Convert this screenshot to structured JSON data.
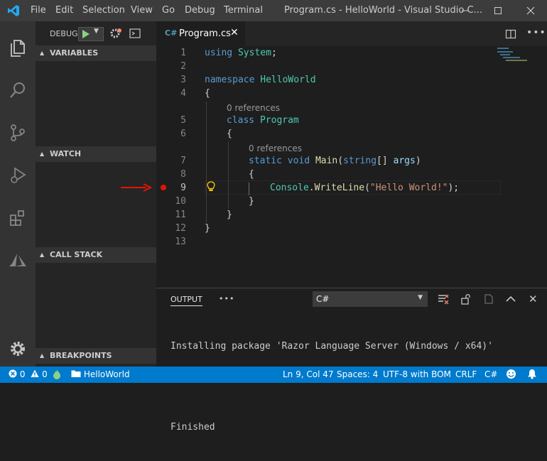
{
  "titlebar": {
    "menu": [
      "File",
      "Edit",
      "Selection",
      "View",
      "Go",
      "Debug",
      "Terminal"
    ],
    "title": "Program.cs - HelloWorld - Visual Studio C..."
  },
  "sidebar": {
    "debug_label": "DEBUG",
    "sections": [
      "VARIABLES",
      "WATCH",
      "CALL STACK",
      "BREAKPOINTS"
    ]
  },
  "tab": {
    "label": "Program.cs"
  },
  "editor": {
    "line_numbers": [
      "1",
      "2",
      "3",
      "4",
      "5",
      "6",
      "7",
      "8",
      "9",
      "10",
      "11",
      "12",
      "13"
    ],
    "code_lens": [
      "0 references",
      "0 references"
    ],
    "lines": {
      "l1_kw": "using",
      "l1_ns": "System",
      "l1_end": ";",
      "l3_kw": "namespace",
      "l3_name": "HelloWorld",
      "l4": "{",
      "l5_kw": "class",
      "l5_name": "Program",
      "l6": "{",
      "l7_kw1": "static",
      "l7_kw2": "void",
      "l7_fn": "Main",
      "l7_p1": "(",
      "l7_type": "string",
      "l7_p2": "[]",
      "l7_arg": "args",
      "l7_p3": ")",
      "l8": "{",
      "l9_cls": "Console",
      "l9_dot": ".",
      "l9_fn": "WriteLine",
      "l9_p1": "(",
      "l9_str": "\"Hello World!\"",
      "l9_p2": ");",
      "l10": "}",
      "l11": "}",
      "l12": "}"
    },
    "current_line": "9"
  },
  "panel": {
    "tab": "OUTPUT",
    "more": "•••",
    "channel": "C#",
    "output_lines": [
      "Installing package 'Razor Language Server (Windows / x64)'",
      "",
      "Finished"
    ]
  },
  "statusbar": {
    "errors": "0",
    "warnings": "0",
    "project": "HelloWorld",
    "position": "Ln 9, Col 47",
    "spaces": "Spaces: 4",
    "encoding": "UTF-8 with BOM",
    "eol": "CRLF",
    "language": "C#"
  },
  "colors": {
    "statusbar": "#007acc",
    "breakpoint": "#e51400",
    "arrow": "#e51400",
    "play": "#89d185"
  }
}
